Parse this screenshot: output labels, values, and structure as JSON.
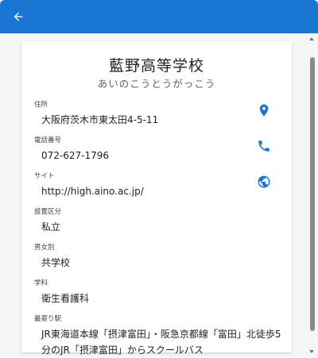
{
  "app_bar": {
    "back_icon": "arrow-back-icon",
    "color": "#1976d2"
  },
  "school": {
    "name": "藍野高等学校",
    "reading": "あいのこうとうがっこう"
  },
  "fields": {
    "address": {
      "label": "住所",
      "value": "大阪府茨木市東太田4-5-11",
      "icon": "location-pin-icon"
    },
    "phone": {
      "label": "電話番号",
      "value": "072-627-1796",
      "icon": "phone-icon"
    },
    "site": {
      "label": "サイト",
      "value": "http://high.aino.ac.jp/",
      "icon": "globe-icon"
    },
    "establishment": {
      "label": "設置区分",
      "value": "私立"
    },
    "gender": {
      "label": "男女別",
      "value": "共学校"
    },
    "department": {
      "label": "学科",
      "value": "衛生看護科"
    },
    "station": {
      "label": "最寄り駅",
      "value": "JR東海道本線「摂津富田」・阪急京都線「富田」北徒歩5分のJR「摂津富田」からスクールバス"
    }
  },
  "accent_color": "#1976d2"
}
